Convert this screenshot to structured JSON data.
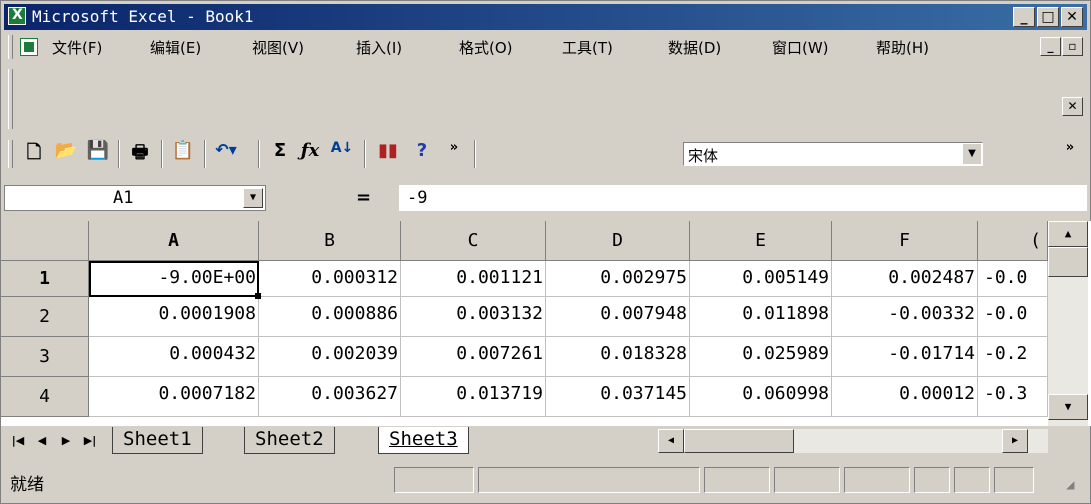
{
  "window": {
    "title": "Microsoft Excel - Book1"
  },
  "menu": {
    "items": [
      "文件(F)",
      "编辑(E)",
      "视图(V)",
      "插入(I)",
      "格式(O)",
      "工具(T)",
      "数据(D)",
      "窗口(W)",
      "帮助(H)"
    ]
  },
  "toolbar": {
    "font_name": "宋体",
    "icons": [
      "new-icon",
      "open-icon",
      "save-icon",
      "print-icon",
      "paste-icon",
      "undo-icon",
      "autosum-icon",
      "function-icon",
      "sort-ascending-icon",
      "chart-wizard-icon",
      "help-icon",
      "toolbar-options-icon"
    ]
  },
  "formula": {
    "name_box": "A1",
    "equals": "=",
    "value": "-9"
  },
  "grid": {
    "columns": [
      "A",
      "B",
      "C",
      "D",
      "E",
      "F",
      "("
    ],
    "rows": [
      {
        "n": "1",
        "cells": [
          "-9.00E+00",
          "0.000312",
          "0.001121",
          "0.002975",
          "0.005149",
          "0.002487",
          "-0.0"
        ]
      },
      {
        "n": "2",
        "cells": [
          "0.0001908",
          "0.000886",
          "0.003132",
          "0.007948",
          "0.011898",
          "-0.00332",
          "-0.0"
        ]
      },
      {
        "n": "3",
        "cells": [
          "0.000432",
          "0.002039",
          "0.007261",
          "0.018328",
          "0.025989",
          "-0.01714",
          "-0.2"
        ]
      },
      {
        "n": "4",
        "cells": [
          "0.0007182",
          "0.003627",
          "0.013719",
          "0.037145",
          "0.060998",
          "0.00012",
          "-0.3"
        ]
      }
    ]
  },
  "sheets": {
    "tabs": [
      "Sheet1",
      "Sheet2",
      "Sheet3"
    ],
    "active": "Sheet3"
  },
  "status": {
    "text": "就绪"
  }
}
